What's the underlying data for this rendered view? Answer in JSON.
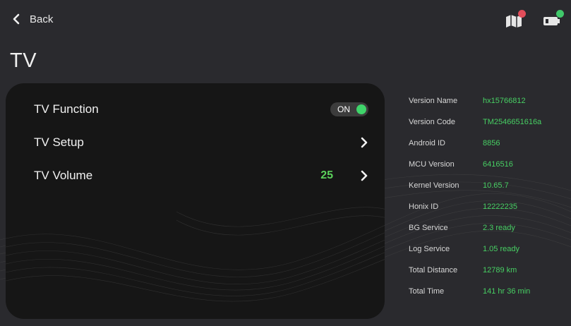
{
  "header": {
    "back_label": "Back",
    "title": "TV"
  },
  "status_icons": [
    {
      "name": "map-error-icon",
      "badge_color": "#e24d5a"
    },
    {
      "name": "battery-ok-icon",
      "badge_color": "#40c86a"
    }
  ],
  "settings": {
    "rows": [
      {
        "label": "TV Function",
        "control": "toggle",
        "toggle_text": "ON",
        "on": true
      },
      {
        "label": "TV Setup",
        "control": "chevron"
      },
      {
        "label": "TV Volume",
        "control": "chevron",
        "value": "25"
      }
    ]
  },
  "info": [
    {
      "key": "Version Name",
      "value": "hx15766812"
    },
    {
      "key": "Version Code",
      "value": "TM2546651616a"
    },
    {
      "key": "Android ID",
      "value": "8856"
    },
    {
      "key": "MCU Version",
      "value": "6416516"
    },
    {
      "key": "Kernel Version",
      "value": "10.65.7"
    },
    {
      "key": "Honix ID",
      "value": "12222235"
    },
    {
      "key": "BG Service",
      "value": "2.3 ready"
    },
    {
      "key": "Log Service",
      "value": "1.05 ready"
    },
    {
      "key": "Total Distance",
      "value": "12789 km"
    },
    {
      "key": "Total Time",
      "value": "141 hr 36 min"
    }
  ],
  "colors": {
    "accent_green": "#47cf63",
    "background": "#2a2a2e",
    "panel": "#161616"
  }
}
